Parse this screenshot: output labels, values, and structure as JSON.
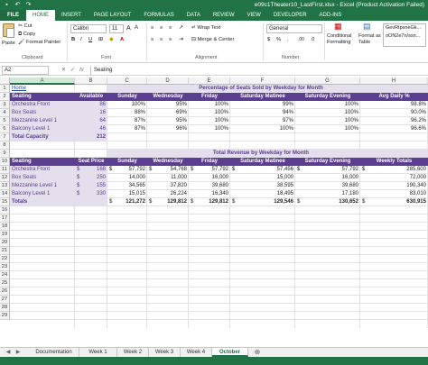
{
  "titlebar": {
    "title": "e09c1Theater10_LastFirst.xlsx - Excel (Product Activation Failed)",
    "qat": [
      "save-icon",
      "undo-icon",
      "redo-icon"
    ]
  },
  "ribbon_tabs": [
    "FILE",
    "HOME",
    "INSERT",
    "PAGE LAYOUT",
    "FORMULAS",
    "DATA",
    "REVIEW",
    "VIEW",
    "DEVELOPER",
    "ADD-INS"
  ],
  "ribbon": {
    "paste": "Paste",
    "cut": "Cut",
    "copy": "Copy",
    "format_painter": "Format Painter",
    "clipboard": "Clipboard",
    "font_name": "Calibri",
    "font_size": "11",
    "font": "Font",
    "wrap_text": "Wrap Text",
    "merge_center": "Merge & Center",
    "alignment": "Alignment",
    "number_format": "General",
    "number": "Number",
    "conditional_formatting": "Conditional Formatting",
    "format_as_table": "Format as Table",
    "style1": "GevRtpsneGk...",
    "style2": "oON2e7n/ssn..."
  },
  "formula_bar": {
    "name_box": "A2",
    "content": "Seating"
  },
  "columns": [
    "A",
    "B",
    "C",
    "D",
    "E",
    "F",
    "G",
    "H"
  ],
  "rows": [
    "1",
    "2",
    "3",
    "4",
    "5",
    "6",
    "7",
    "8",
    "9",
    "10",
    "11",
    "12",
    "13",
    "14",
    "15",
    "16",
    "17",
    "18",
    "19",
    "20",
    "21",
    "22",
    "23",
    "24",
    "25",
    "26",
    "27",
    "28",
    "29"
  ],
  "sheet": {
    "home_link": "Home",
    "table1_title": "Percentage of Seats Sold by Weekday for Month",
    "table1_headers": [
      "Seating",
      "Available",
      "Sunday",
      "Wednesday",
      "Friday",
      "Saturday Matinee",
      "Saturday Evening",
      "Avg Daily %"
    ],
    "table1_rows": [
      [
        "Orchestra  Front",
        "86",
        "100%",
        "95%",
        "100%",
        "99%",
        "100%",
        "98.8%"
      ],
      [
        "Box Seats",
        "16",
        "88%",
        "69%",
        "100%",
        "94%",
        "100%",
        "90.0%"
      ],
      [
        "Mezzanine Level 1",
        "64",
        "87%",
        "95%",
        "100%",
        "97%",
        "100%",
        "96.2%"
      ],
      [
        "Balcony Level 1",
        "46",
        "87%",
        "96%",
        "100%",
        "100%",
        "100%",
        "96.6%"
      ]
    ],
    "total_capacity_label": "Total Capacity",
    "total_capacity_value": "212",
    "table2_title": "Total Revenue by Weekday for Month",
    "table2_headers": [
      "Seating",
      "Seat Price",
      "Sunday",
      "Wednesday",
      "Friday",
      "Saturday Matinee",
      "Saturday Evening",
      "Weekly Totals"
    ],
    "table2_rows": [
      [
        "Orchestra  Front",
        "$",
        "168",
        "$",
        "57,792",
        "$",
        "54,768",
        "$",
        "57,792",
        "$",
        "57,456",
        "$",
        "57,792",
        "$",
        "285,600"
      ],
      [
        "Box Seats",
        "$",
        "250",
        "",
        "14,000",
        "",
        "11,000",
        "",
        "16,000",
        "",
        "15,000",
        "",
        "16,000",
        "",
        "72,000"
      ],
      [
        "Mezzanine Level 1",
        "$",
        "155",
        "",
        "34,565",
        "",
        "37,820",
        "",
        "39,680",
        "",
        "38,595",
        "",
        "39,680",
        "",
        "190,340"
      ],
      [
        "Balcony Level 1",
        "$",
        "330",
        "",
        "15,015",
        "",
        "26,224",
        "",
        "16,340",
        "",
        "18,495",
        "",
        "17,180",
        "",
        "83,010"
      ]
    ],
    "totals_row": [
      "Totals",
      "",
      "",
      "$",
      "121,272",
      "$",
      "129,812",
      "$",
      "129,812",
      "$",
      "129,546",
      "$",
      "130,652",
      "$",
      "630,915"
    ]
  },
  "sheet_tabs": [
    "Documentation",
    "Week 1",
    "Week 2",
    "Week 3",
    "Week 4",
    "October"
  ],
  "active_sheet": "October",
  "colors": {
    "excel_green": "#217346",
    "header_purple": "#5b3e8f",
    "title_band": "#e4dfec",
    "label_lavender": "#e4dfec",
    "link_blue": "#1f4e9c"
  }
}
